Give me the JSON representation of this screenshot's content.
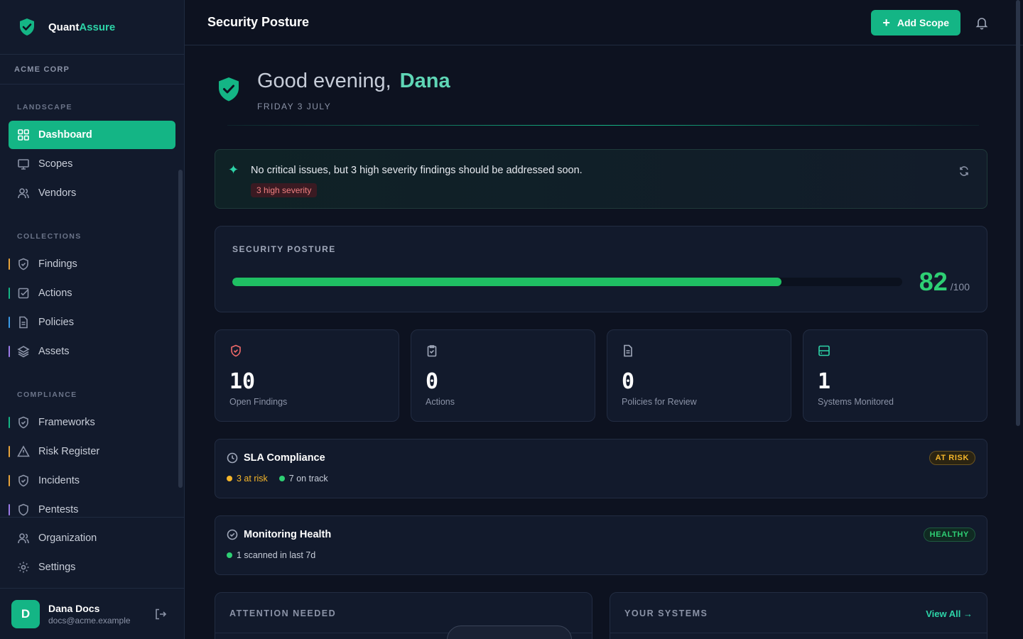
{
  "brand": {
    "name_prefix": "Quant",
    "name_suffix": "Assure"
  },
  "org": {
    "name": "ACME CORP"
  },
  "sidebar": {
    "sections": [
      {
        "label": "LANDSCAPE",
        "items": [
          {
            "label": "Dashboard",
            "icon": "grid-icon",
            "active": true
          },
          {
            "label": "Scopes",
            "icon": "monitor-icon"
          },
          {
            "label": "Vendors",
            "icon": "users-icon"
          }
        ]
      },
      {
        "label": "COLLECTIONS",
        "items": [
          {
            "label": "Findings",
            "icon": "shield-icon",
            "color": "#e8a33a"
          },
          {
            "label": "Actions",
            "icon": "checkbox-icon",
            "color": "#14b585"
          },
          {
            "label": "Policies",
            "icon": "document-icon",
            "color": "#3b9be8"
          },
          {
            "label": "Assets",
            "icon": "layers-icon",
            "color": "#9b7be8"
          }
        ]
      },
      {
        "label": "COMPLIANCE",
        "items": [
          {
            "label": "Frameworks",
            "icon": "shield-check-icon",
            "color": "#14b585"
          },
          {
            "label": "Risk Register",
            "icon": "warning-icon",
            "color": "#e8a33a"
          },
          {
            "label": "Incidents",
            "icon": "shield-alert-icon",
            "color": "#e8a33a"
          },
          {
            "label": "Pentests",
            "icon": "shield-icon",
            "color": "#9b7be8"
          }
        ]
      }
    ],
    "bottom": [
      {
        "label": "Organization",
        "icon": "users-icon"
      },
      {
        "label": "Settings",
        "icon": "gear-icon"
      }
    ]
  },
  "user": {
    "initial": "D",
    "name": "Dana Docs",
    "email": "docs@acme.example"
  },
  "header": {
    "title": "Security Posture",
    "add_label": "Add Scope"
  },
  "greeting": {
    "prefix": "Good evening,",
    "name": "Dana",
    "date": "FRIDAY 3 JULY"
  },
  "alert": {
    "message": "No critical issues, but 3 high severity findings should be addressed soon.",
    "badge": "3 high severity"
  },
  "posture": {
    "label": "SECURITY POSTURE",
    "score": "82",
    "max": "/100",
    "fraction": 0.82
  },
  "stats": [
    {
      "value": "10",
      "label": "Open Findings",
      "icon": "shield-icon",
      "color": "#f06a6a"
    },
    {
      "value": "0",
      "label": "Actions",
      "icon": "clipboard-check-icon",
      "color": "#a0a8ba"
    },
    {
      "value": "0",
      "label": "Policies for Review",
      "icon": "document-icon",
      "color": "#a0a8ba"
    },
    {
      "value": "1",
      "label": "Systems Monitored",
      "icon": "server-icon",
      "color": "#2dd4a8"
    }
  ],
  "sla": {
    "title": "SLA Compliance",
    "at_risk": "3 at risk",
    "on_track": "7 on track",
    "status": "AT RISK"
  },
  "monitoring": {
    "title": "Monitoring Health",
    "scanned": "1 scanned in last 7d",
    "status": "HEALTHY"
  },
  "attention": {
    "title": "ATTENTION NEEDED"
  },
  "systems": {
    "title": "YOUR SYSTEMS",
    "view_all": "View All →"
  },
  "colors": {
    "accent": "#14b585",
    "success": "#2ecf74",
    "warning": "#f5b62a",
    "danger": "#f06a6a"
  }
}
